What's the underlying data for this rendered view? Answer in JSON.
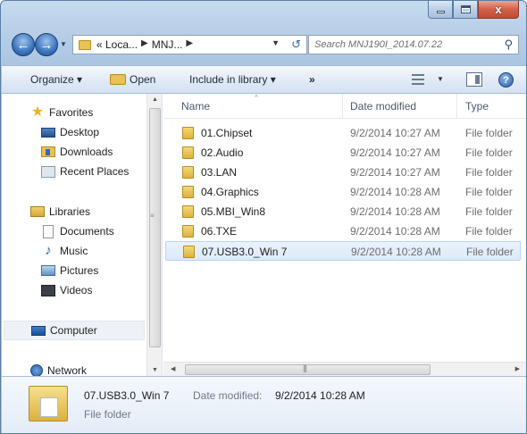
{
  "window": {
    "controls": {
      "minimize": "–",
      "maximize": "□",
      "close": "x"
    }
  },
  "address": {
    "crumbs": [
      "« Loca...",
      "MNJ..."
    ],
    "search_placeholder": "Search MNJ190I_2014.07.22"
  },
  "toolbar": {
    "organize": "Organize ▾",
    "open": "Open",
    "include": "Include in library ▾",
    "more": "»",
    "help": "?"
  },
  "nav": {
    "favorites": "Favorites",
    "desktop": "Desktop",
    "downloads": "Downloads",
    "recent": "Recent Places",
    "libraries": "Libraries",
    "documents": "Documents",
    "music": "Music",
    "pictures": "Pictures",
    "videos": "Videos",
    "computer": "Computer",
    "network": "Network"
  },
  "columns": {
    "name": "Name",
    "date": "Date modified",
    "type": "Type"
  },
  "files": [
    {
      "name": "01.Chipset",
      "date": "9/2/2014 10:27 AM",
      "type": "File folder"
    },
    {
      "name": "02.Audio",
      "date": "9/2/2014 10:27 AM",
      "type": "File folder"
    },
    {
      "name": "03.LAN",
      "date": "9/2/2014 10:27 AM",
      "type": "File folder"
    },
    {
      "name": "04.Graphics",
      "date": "9/2/2014 10:28 AM",
      "type": "File folder"
    },
    {
      "name": "05.MBI_Win8",
      "date": "9/2/2014 10:28 AM",
      "type": "File folder"
    },
    {
      "name": "06.TXE",
      "date": "9/2/2014 10:28 AM",
      "type": "File folder"
    },
    {
      "name": "07.USB3.0_Win 7",
      "date": "9/2/2014 10:28 AM",
      "type": "File folder"
    }
  ],
  "selected_index": 6,
  "details": {
    "name": "07.USB3.0_Win 7",
    "date_label": "Date modified:",
    "date": "9/2/2014 10:28 AM",
    "type": "File folder"
  },
  "colors": {
    "accent": "#3a74bd",
    "selection": "#dceaf9",
    "folder": "#ddb23f",
    "close_button": "#c24a33"
  }
}
